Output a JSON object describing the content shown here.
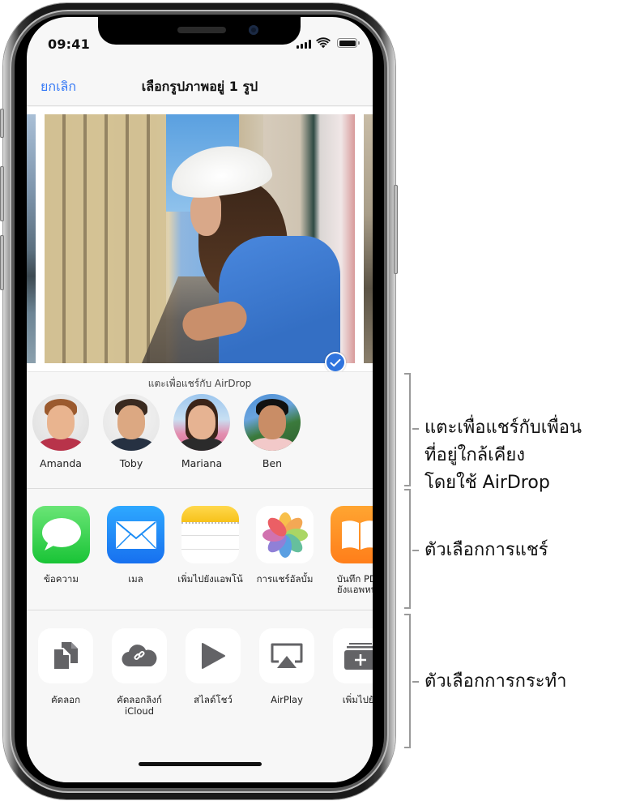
{
  "status_bar": {
    "time": "09:41",
    "icons": [
      "signal-icon",
      "wifi-icon",
      "battery-icon"
    ]
  },
  "nav": {
    "cancel_label": "ยกเลิก",
    "title": "เลือกรูปภาพอยู่ 1 รูป"
  },
  "photos": {
    "selected_count": 1,
    "items": [
      {
        "name": "previous-photo",
        "selected": false
      },
      {
        "name": "balcony-photo",
        "selected": true
      },
      {
        "name": "next-photo",
        "selected": false
      }
    ],
    "accent_color": "#2f74de"
  },
  "airdrop": {
    "hint": "แตะเพื่อแชร์กับ AirDrop",
    "people": [
      {
        "name": "Amanda"
      },
      {
        "name": "Toby"
      },
      {
        "name": "Mariana"
      },
      {
        "name": "Ben"
      }
    ]
  },
  "share_apps": [
    {
      "label": "ข้อความ",
      "icon": "messages-icon",
      "color": "#34c759"
    },
    {
      "label": "เมล",
      "icon": "mail-icon",
      "color": "#1a8cf5"
    },
    {
      "label": "เพิ่มไปยังแอพโน้",
      "icon": "notes-icon",
      "color": "#ffd52e"
    },
    {
      "label": "การแชร์อัลบั้ม",
      "icon": "photos-icon",
      "color": "#ffffff"
    },
    {
      "label": "บันทึก PDF",
      "label2": "ยังแอพหนัง",
      "icon": "books-icon",
      "color": "#ff9500"
    }
  ],
  "actions": [
    {
      "label": "คัดลอก",
      "icon": "copy-icon"
    },
    {
      "label": "คัดลอกลิงก์",
      "label2": "iCloud",
      "icon": "icloud-link-icon"
    },
    {
      "label": "สไลด์โชว์",
      "icon": "slideshow-icon"
    },
    {
      "label": "AirPlay",
      "icon": "airplay-icon"
    },
    {
      "label": "เพิ่มไปยัง",
      "icon": "add-to-album-icon"
    }
  ],
  "callouts": {
    "airdrop_line1": "แตะเพื่อแชร์กับเพื่อน",
    "airdrop_line2": "ที่อยู่ใกล้เคียง",
    "airdrop_line3": "โดยใช้ AirDrop",
    "share_options": "ตัวเลือกการแชร์",
    "action_options": "ตัวเลือกการกระทำ"
  }
}
